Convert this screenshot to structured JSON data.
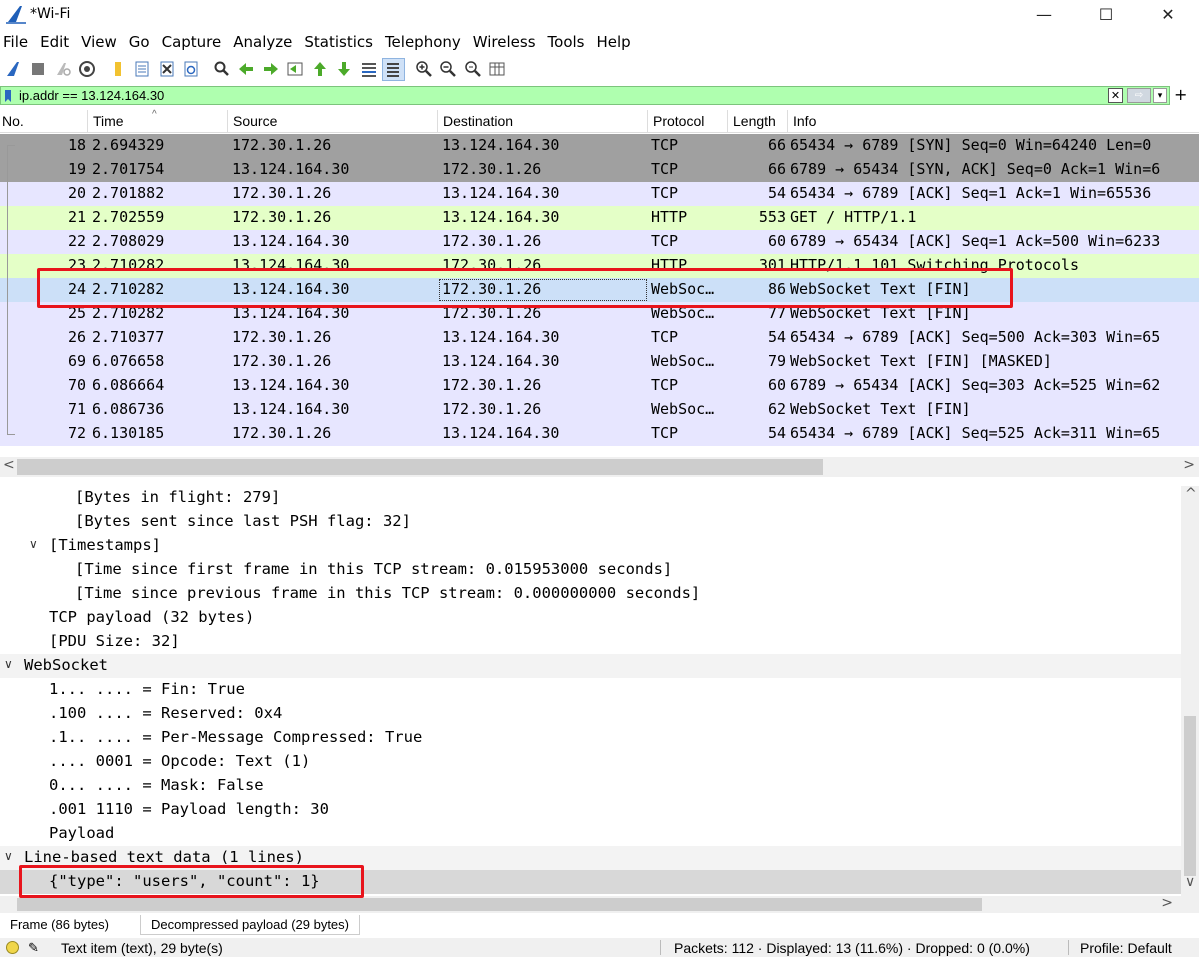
{
  "window": {
    "title": "*Wi-Fi",
    "minimize_glyph": "—",
    "maximize_glyph": "☐",
    "close_glyph": "✕"
  },
  "menu": [
    "File",
    "Edit",
    "View",
    "Go",
    "Capture",
    "Analyze",
    "Statistics",
    "Telephony",
    "Wireless",
    "Tools",
    "Help"
  ],
  "toolbar": {
    "icons": [
      "shark-fin-start-icon",
      "stop-icon",
      "restart-icon",
      "capture-options-icon",
      "open-file-icon",
      "file-set-icon",
      "close-file-icon",
      "reload-icon",
      "find-packet-icon",
      "go-back-icon",
      "go-forward-icon",
      "go-to-packet-icon",
      "first-packet-icon",
      "last-packet-icon",
      "auto-scroll-icon",
      "colorize-icon",
      "zoom-in-icon",
      "zoom-out-icon",
      "normal-size-icon",
      "resize-columns-icon"
    ]
  },
  "filter": {
    "value": "ip.addr == 13.124.164.30",
    "bg_color": "#afffaf",
    "plus": "+"
  },
  "packet_list": {
    "columns": [
      "No.",
      "Time",
      "Source",
      "Destination",
      "Protocol",
      "Length",
      "Info"
    ],
    "rows": [
      {
        "no": "18",
        "time": "2.694329",
        "src": "172.30.1.26",
        "dst": "13.124.164.30",
        "proto": "TCP",
        "len": "66",
        "info": "65434 → 6789 [SYN] Seq=0 Win=64240 Len=0",
        "bg": "#a0a0a0"
      },
      {
        "no": "19",
        "time": "2.701754",
        "src": "13.124.164.30",
        "dst": "172.30.1.26",
        "proto": "TCP",
        "len": "66",
        "info": "6789 → 65434 [SYN, ACK] Seq=0 Ack=1 Win=6",
        "bg": "#a0a0a0"
      },
      {
        "no": "20",
        "time": "2.701882",
        "src": "172.30.1.26",
        "dst": "13.124.164.30",
        "proto": "TCP",
        "len": "54",
        "info": "65434 → 6789 [ACK] Seq=1 Ack=1 Win=65536",
        "bg": "#e7e6ff"
      },
      {
        "no": "21",
        "time": "2.702559",
        "src": "172.30.1.26",
        "dst": "13.124.164.30",
        "proto": "HTTP",
        "len": "553",
        "info": "GET / HTTP/1.1",
        "bg": "#e4ffc7"
      },
      {
        "no": "22",
        "time": "2.708029",
        "src": "13.124.164.30",
        "dst": "172.30.1.26",
        "proto": "TCP",
        "len": "60",
        "info": "6789 → 65434 [ACK] Seq=1 Ack=500 Win=6233",
        "bg": "#e7e6ff"
      },
      {
        "no": "23",
        "time": "2.710282",
        "src": "13.124.164.30",
        "dst": "172.30.1.26",
        "proto": "HTTP",
        "len": "301",
        "info": "HTTP/1.1 101 Switching Protocols",
        "bg": "#e4ffc7"
      },
      {
        "no": "24",
        "time": "2.710282",
        "src": "13.124.164.30",
        "dst": "172.30.1.26",
        "proto": "WebSoc…",
        "len": "86",
        "info": "WebSocket Text [FIN]",
        "bg": "#cce0f8"
      },
      {
        "no": "25",
        "time": "2.710282",
        "src": "13.124.164.30",
        "dst": "172.30.1.26",
        "proto": "WebSoc…",
        "len": "77",
        "info": "WebSocket Text [FIN]",
        "bg": "#e7e6ff"
      },
      {
        "no": "26",
        "time": "2.710377",
        "src": "172.30.1.26",
        "dst": "13.124.164.30",
        "proto": "TCP",
        "len": "54",
        "info": "65434 → 6789 [ACK] Seq=500 Ack=303 Win=65",
        "bg": "#e7e6ff"
      },
      {
        "no": "69",
        "time": "6.076658",
        "src": "172.30.1.26",
        "dst": "13.124.164.30",
        "proto": "WebSoc…",
        "len": "79",
        "info": "WebSocket Text [FIN] [MASKED]",
        "bg": "#e7e6ff"
      },
      {
        "no": "70",
        "time": "6.086664",
        "src": "13.124.164.30",
        "dst": "172.30.1.26",
        "proto": "TCP",
        "len": "60",
        "info": "6789 → 65434 [ACK] Seq=303 Ack=525 Win=62",
        "bg": "#e7e6ff"
      },
      {
        "no": "71",
        "time": "6.086736",
        "src": "13.124.164.30",
        "dst": "172.30.1.26",
        "proto": "WebSoc…",
        "len": "62",
        "info": "WebSocket Text [FIN]",
        "bg": "#e7e6ff"
      },
      {
        "no": "72",
        "time": "6.130185",
        "src": "172.30.1.26",
        "dst": "13.124.164.30",
        "proto": "TCP",
        "len": "54",
        "info": "65434 → 6789 [ACK] Seq=525 Ack=311 Win=65",
        "bg": "#e7e6ff"
      }
    ]
  },
  "details": {
    "rows": [
      {
        "text": "[Bytes in flight: 279]",
        "indent": 3,
        "twisty": "",
        "kind": ""
      },
      {
        "text": "[Bytes sent since last PSH flag: 32]",
        "indent": 3,
        "twisty": "",
        "kind": ""
      },
      {
        "text": "[Timestamps]",
        "indent": 2,
        "twisty": "∨",
        "kind": ""
      },
      {
        "text": "[Time since first frame in this TCP stream: 0.015953000 seconds]",
        "indent": 3,
        "twisty": "",
        "kind": ""
      },
      {
        "text": "[Time since previous frame in this TCP stream: 0.000000000 seconds]",
        "indent": 3,
        "twisty": "",
        "kind": ""
      },
      {
        "text": "TCP payload (32 bytes)",
        "indent": 2,
        "twisty": "",
        "kind": ""
      },
      {
        "text": "[PDU Size: 32]",
        "indent": 2,
        "twisty": "",
        "kind": ""
      },
      {
        "text": "WebSocket",
        "indent": 1,
        "twisty": "∨",
        "kind": "sect"
      },
      {
        "text": "1... .... = Fin: True",
        "indent": 2,
        "twisty": "",
        "kind": ""
      },
      {
        "text": ".100 .... = Reserved: 0x4",
        "indent": 2,
        "twisty": "",
        "kind": ""
      },
      {
        "text": ".1.. .... = Per-Message Compressed: True",
        "indent": 2,
        "twisty": "",
        "kind": ""
      },
      {
        "text": ".... 0001 = Opcode: Text (1)",
        "indent": 2,
        "twisty": "",
        "kind": ""
      },
      {
        "text": "0... .... = Mask: False",
        "indent": 2,
        "twisty": "",
        "kind": ""
      },
      {
        "text": ".001 1110 = Payload length: 30",
        "indent": 2,
        "twisty": "",
        "kind": ""
      },
      {
        "text": "Payload",
        "indent": 2,
        "twisty": "",
        "kind": ""
      },
      {
        "text": "Line-based text data (1 lines)",
        "indent": 1,
        "twisty": "∨",
        "kind": "sect"
      },
      {
        "text": "{\"type\": \"users\", \"count\": 1}",
        "indent": 2,
        "twisty": "",
        "kind": "sel"
      }
    ]
  },
  "bytes_tabs": [
    "Frame (86 bytes)",
    "Decompressed payload (29 bytes)"
  ],
  "status": {
    "edit_glyph": "✎",
    "text": "Text item (text), 29 byte(s)",
    "packets": "Packets: 112 · Displayed: 13 (11.6%) · Dropped: 0 (0.0%)",
    "profile": "Profile: Default"
  },
  "scroll": {
    "left": "<",
    "right": ">",
    "up": "^",
    "down": "∨"
  },
  "colors": {
    "annotation": "#e8141c",
    "filter_valid": "#afffaf",
    "selected_row": "#cce0f8"
  }
}
